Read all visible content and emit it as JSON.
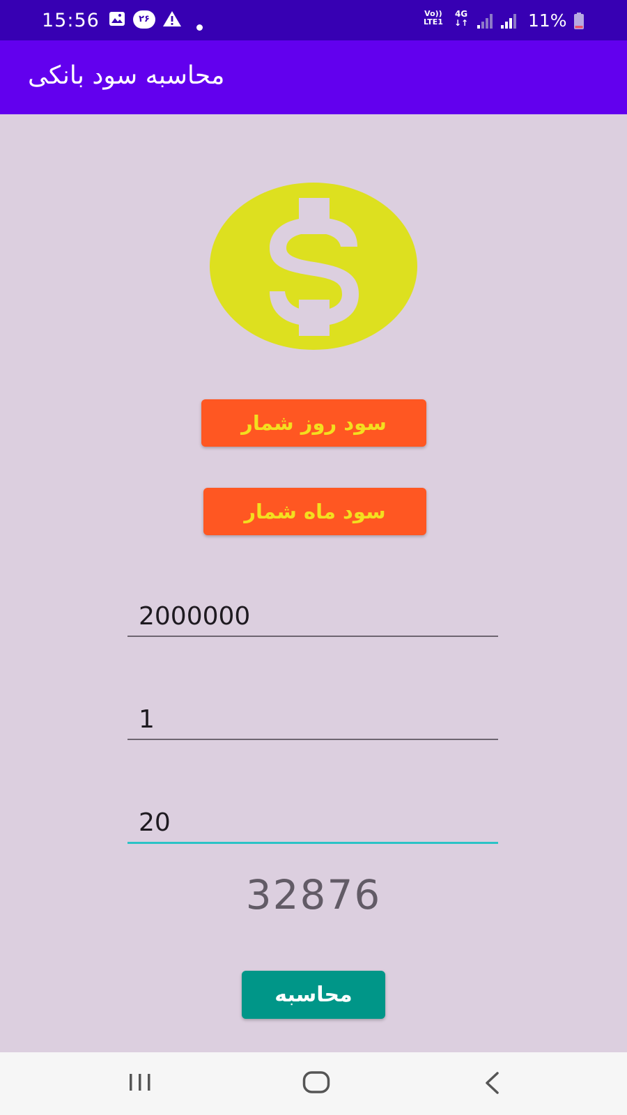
{
  "status_bar": {
    "time": "15:56",
    "notification_badge": "۲۶",
    "volte_line1": "Vo))",
    "volte_line2": "LTE1",
    "network": "4G",
    "battery": "11%"
  },
  "app_bar": {
    "title": "محاسبه سود بانکی"
  },
  "icons": {
    "logo": "dollar-coin-icon"
  },
  "buttons": {
    "daily_interest": "سود روز شمار",
    "monthly_interest": "سود ماه شمار",
    "calculate": "محاسبه"
  },
  "form": {
    "amount": "2000000",
    "duration": "1",
    "rate": "20"
  },
  "result": "32876",
  "colors": {
    "status_bar": "#3700B3",
    "app_bar": "#6200EE",
    "background": "#DCCFDF",
    "coin": "#DDE01F",
    "option_button": "#FF5722",
    "option_text": "#F3DF1F",
    "calc_button": "#009688",
    "focus_line": "#2BC3C6"
  }
}
